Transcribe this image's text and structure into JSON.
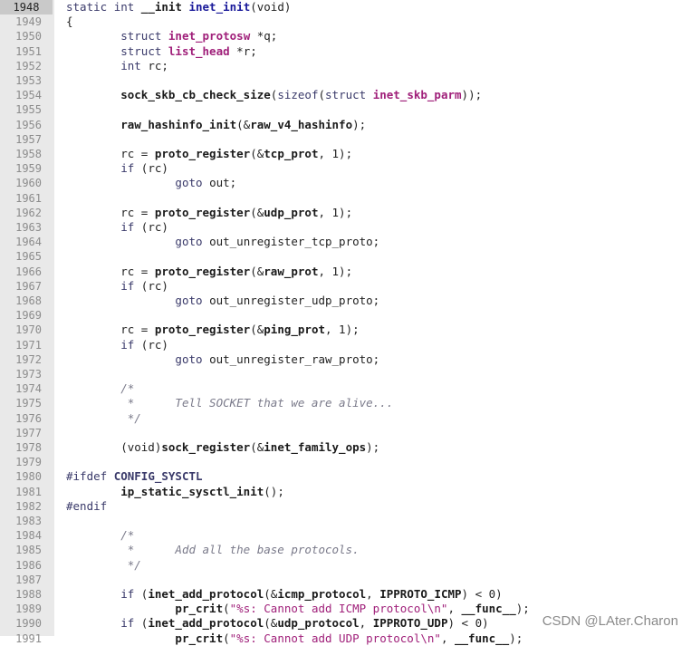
{
  "current_line": 1948,
  "watermark": "CSDN @LAter.Charon",
  "lines": [
    {
      "n": "1948",
      "t": [
        [
          "kw",
          "static "
        ],
        [
          "ty",
          "int "
        ],
        [
          "fn",
          "__init "
        ],
        [
          "decl",
          "inet_init"
        ],
        [
          "",
          "(void)"
        ]
      ]
    },
    {
      "n": "1949",
      "t": [
        [
          "",
          "{"
        ]
      ]
    },
    {
      "n": "1950",
      "t": [
        [
          "",
          "        "
        ],
        [
          "kw",
          "struct "
        ],
        [
          "ident",
          "inet_protosw "
        ],
        [
          "",
          "*q;"
        ]
      ]
    },
    {
      "n": "1951",
      "t": [
        [
          "",
          "        "
        ],
        [
          "kw",
          "struct "
        ],
        [
          "ident",
          "list_head "
        ],
        [
          "",
          "*r;"
        ]
      ]
    },
    {
      "n": "1952",
      "t": [
        [
          "",
          "        "
        ],
        [
          "ty",
          "int "
        ],
        [
          "",
          "rc;"
        ]
      ]
    },
    {
      "n": "1953",
      "t": [
        [
          "",
          ""
        ]
      ]
    },
    {
      "n": "1954",
      "t": [
        [
          "",
          "        "
        ],
        [
          "fn",
          "sock_skb_cb_check_size"
        ],
        [
          "",
          "("
        ],
        [
          "kw",
          "sizeof"
        ],
        [
          "",
          "("
        ],
        [
          "kw",
          "struct "
        ],
        [
          "ident",
          "inet_skb_parm"
        ],
        [
          "",
          "));"
        ]
      ]
    },
    {
      "n": "1955",
      "t": [
        [
          "",
          ""
        ]
      ]
    },
    {
      "n": "1956",
      "t": [
        [
          "",
          "        "
        ],
        [
          "fn",
          "raw_hashinfo_init"
        ],
        [
          "",
          "(&"
        ],
        [
          "fn",
          "raw_v4_hashinfo"
        ],
        [
          "",
          ");"
        ]
      ]
    },
    {
      "n": "1957",
      "t": [
        [
          "",
          ""
        ]
      ]
    },
    {
      "n": "1958",
      "t": [
        [
          "",
          "        rc = "
        ],
        [
          "fn",
          "proto_register"
        ],
        [
          "",
          "(&"
        ],
        [
          "fn",
          "tcp_prot"
        ],
        [
          "",
          ", 1);"
        ]
      ]
    },
    {
      "n": "1959",
      "t": [
        [
          "",
          "        "
        ],
        [
          "kw",
          "if "
        ],
        [
          "",
          "(rc)"
        ]
      ]
    },
    {
      "n": "1960",
      "t": [
        [
          "",
          "                "
        ],
        [
          "kw",
          "goto "
        ],
        [
          "",
          "out;"
        ]
      ]
    },
    {
      "n": "1961",
      "t": [
        [
          "",
          ""
        ]
      ]
    },
    {
      "n": "1962",
      "t": [
        [
          "",
          "        rc = "
        ],
        [
          "fn",
          "proto_register"
        ],
        [
          "",
          "(&"
        ],
        [
          "fn",
          "udp_prot"
        ],
        [
          "",
          ", 1);"
        ]
      ]
    },
    {
      "n": "1963",
      "t": [
        [
          "",
          "        "
        ],
        [
          "kw",
          "if "
        ],
        [
          "",
          "(rc)"
        ]
      ]
    },
    {
      "n": "1964",
      "t": [
        [
          "",
          "                "
        ],
        [
          "kw",
          "goto "
        ],
        [
          "",
          "out_unregister_tcp_proto;"
        ]
      ]
    },
    {
      "n": "1965",
      "t": [
        [
          "",
          ""
        ]
      ]
    },
    {
      "n": "1966",
      "t": [
        [
          "",
          "        rc = "
        ],
        [
          "fn",
          "proto_register"
        ],
        [
          "",
          "(&"
        ],
        [
          "fn",
          "raw_prot"
        ],
        [
          "",
          ", 1);"
        ]
      ]
    },
    {
      "n": "1967",
      "t": [
        [
          "",
          "        "
        ],
        [
          "kw",
          "if "
        ],
        [
          "",
          "(rc)"
        ]
      ]
    },
    {
      "n": "1968",
      "t": [
        [
          "",
          "                "
        ],
        [
          "kw",
          "goto "
        ],
        [
          "",
          "out_unregister_udp_proto;"
        ]
      ]
    },
    {
      "n": "1969",
      "t": [
        [
          "",
          ""
        ]
      ]
    },
    {
      "n": "1970",
      "t": [
        [
          "",
          "        rc = "
        ],
        [
          "fn",
          "proto_register"
        ],
        [
          "",
          "(&"
        ],
        [
          "fn",
          "ping_prot"
        ],
        [
          "",
          ", 1);"
        ]
      ]
    },
    {
      "n": "1971",
      "t": [
        [
          "",
          "        "
        ],
        [
          "kw",
          "if "
        ],
        [
          "",
          "(rc)"
        ]
      ]
    },
    {
      "n": "1972",
      "t": [
        [
          "",
          "                "
        ],
        [
          "kw",
          "goto "
        ],
        [
          "",
          "out_unregister_raw_proto;"
        ]
      ]
    },
    {
      "n": "1973",
      "t": [
        [
          "",
          ""
        ]
      ]
    },
    {
      "n": "1974",
      "t": [
        [
          "",
          "        "
        ],
        [
          "cm",
          "/*"
        ]
      ]
    },
    {
      "n": "1975",
      "t": [
        [
          "",
          "         "
        ],
        [
          "cm",
          "*      Tell SOCKET that we are alive..."
        ]
      ]
    },
    {
      "n": "1976",
      "t": [
        [
          "",
          "         "
        ],
        [
          "cm",
          "*/"
        ]
      ]
    },
    {
      "n": "1977",
      "t": [
        [
          "",
          ""
        ]
      ]
    },
    {
      "n": "1978",
      "t": [
        [
          "",
          "        (void)"
        ],
        [
          "fn",
          "sock_register"
        ],
        [
          "",
          "(&"
        ],
        [
          "fn",
          "inet_family_ops"
        ],
        [
          "",
          ");"
        ]
      ]
    },
    {
      "n": "1979",
      "t": [
        [
          "",
          ""
        ]
      ]
    },
    {
      "n": "1980",
      "t": [
        [
          "pp",
          "#ifdef "
        ],
        [
          "macro",
          "CONFIG_SYSCTL"
        ]
      ]
    },
    {
      "n": "1981",
      "t": [
        [
          "",
          "        "
        ],
        [
          "fn",
          "ip_static_sysctl_init"
        ],
        [
          "",
          "();"
        ]
      ]
    },
    {
      "n": "1982",
      "t": [
        [
          "pp",
          "#endif"
        ]
      ]
    },
    {
      "n": "1983",
      "t": [
        [
          "",
          ""
        ]
      ]
    },
    {
      "n": "1984",
      "t": [
        [
          "",
          "        "
        ],
        [
          "cm",
          "/*"
        ]
      ]
    },
    {
      "n": "1985",
      "t": [
        [
          "",
          "         "
        ],
        [
          "cm",
          "*      Add all the base protocols."
        ]
      ]
    },
    {
      "n": "1986",
      "t": [
        [
          "",
          "         "
        ],
        [
          "cm",
          "*/"
        ]
      ]
    },
    {
      "n": "1987",
      "t": [
        [
          "",
          ""
        ]
      ]
    },
    {
      "n": "1988",
      "t": [
        [
          "",
          "        "
        ],
        [
          "kw",
          "if "
        ],
        [
          "",
          "("
        ],
        [
          "fn",
          "inet_add_protocol"
        ],
        [
          "",
          "(&"
        ],
        [
          "fn",
          "icmp_protocol"
        ],
        [
          "",
          ", "
        ],
        [
          "fn",
          "IPPROTO_ICMP"
        ],
        [
          "",
          ") < 0)"
        ]
      ]
    },
    {
      "n": "1989",
      "t": [
        [
          "",
          "                "
        ],
        [
          "fn",
          "pr_crit"
        ],
        [
          "",
          "("
        ],
        [
          "str",
          "\"%s: Cannot add ICMP protocol\\n\""
        ],
        [
          "",
          ", "
        ],
        [
          "fn",
          "__func__"
        ],
        [
          "",
          ");"
        ]
      ]
    },
    {
      "n": "1990",
      "t": [
        [
          "",
          "        "
        ],
        [
          "kw",
          "if "
        ],
        [
          "",
          "("
        ],
        [
          "fn",
          "inet_add_protocol"
        ],
        [
          "",
          "(&"
        ],
        [
          "fn",
          "udp_protocol"
        ],
        [
          "",
          ", "
        ],
        [
          "fn",
          "IPPROTO_UDP"
        ],
        [
          "",
          ") < 0)"
        ]
      ]
    },
    {
      "n": "1991",
      "t": [
        [
          "",
          "                "
        ],
        [
          "fn",
          "pr_crit"
        ],
        [
          "",
          "("
        ],
        [
          "str",
          "\"%s: Cannot add UDP protocol\\n\""
        ],
        [
          "",
          ", "
        ],
        [
          "fn",
          "__func__"
        ],
        [
          "",
          ");"
        ]
      ]
    }
  ]
}
